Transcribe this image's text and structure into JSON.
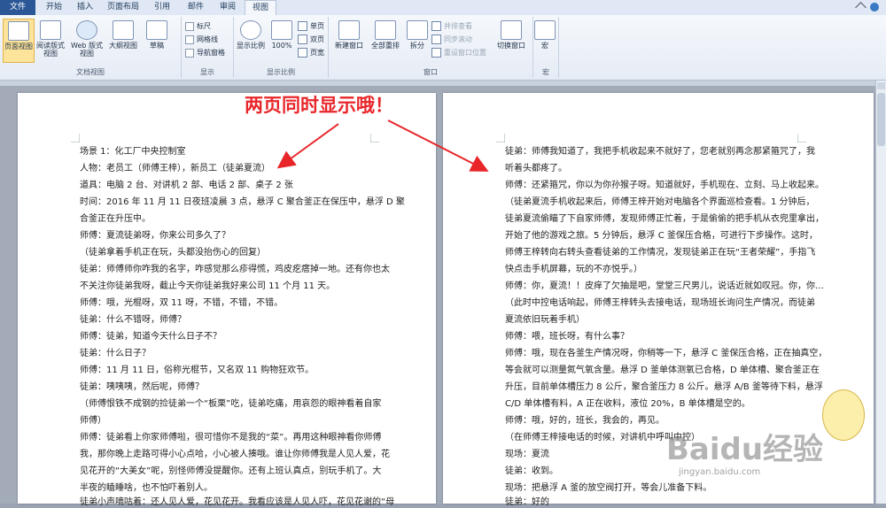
{
  "tabs": [
    "文件",
    "开始",
    "插入",
    "页面布局",
    "引用",
    "邮件",
    "审阅",
    "视图"
  ],
  "ribbon": {
    "doc_views": {
      "group_label": "文档视图",
      "buttons": [
        "页面视图",
        "阅读版式视图",
        "Web 版式视图",
        "大纲视图",
        "草稿"
      ]
    },
    "show": {
      "group_label": "显示",
      "items": [
        "标尺",
        "网格线",
        "导航窗格"
      ]
    },
    "zoom": {
      "group_label": "显示比例",
      "buttons": [
        "显示比例",
        "100%"
      ],
      "small": [
        "单页",
        "双页",
        "页宽"
      ]
    },
    "window": {
      "group_label": "窗口",
      "buttons": [
        "新建窗口",
        "全部重排",
        "拆分"
      ],
      "small": [
        "并排查看",
        "同步滚动",
        "重设窗口位置"
      ],
      "switch": "切换窗口"
    },
    "macro": {
      "group_label": "宏",
      "button": "宏"
    }
  },
  "annotation": "两页同时显示哦！",
  "page_left": [
    "场景 1：化工厂中央控制室",
    "人物：老员工（师傅王梓），新员工（徒弟夏流）",
    "道具：电脑 2 台、对讲机 2 部、电话 2 部、桌子 2 张",
    "时间：2016 年 11 月 11 日夜班凌晨 3 点，悬浮 C 聚合釜正在保压中，悬浮 D 聚",
    "合釜正在升压中。",
    "师傅：夏流徒弟呀，你来公司多久了？",
    "（徒弟拿着手机正在玩，头都没抬伤心的回复）",
    "徒弟：师傅师你咋我的名字，咋感觉那么疹得慌，鸡皮疙瘩掉一地。还有你也太",
    "不关注你徒弟我呀，截止今天你徒弟我好来公司 11 个月 11 天。",
    "师傅：哦，光棍呀，双 11 呀，不错，不错，不错。",
    "徒弟：什么不错呀，师傅？",
    "师傅：徒弟，知道今天什么日子不？",
    "徒弟：什么日子？",
    "师傅：11 月 11 日，俗称光棍节，又名双 11 购物狂欢节。",
    "徒弟：咦咦咦，然后呢，师傅？",
    "（师傅恨铁不成钢的捡徒弟一个“板栗”吃，徒弟吃痛，用哀怨的眼神看着自家",
    "师傅）",
    "师傅：徒弟看上你家师傅啦，很可惜你不是我的“菜”。再用这种眼神看你师傅",
    "我，那你晚上走路可得小心点哈，小心被人揍哦。谁让你师傅我是人见人爱，花",
    "见花开的“大美女”呢，别怪师傅没提醒你。还有上班认真点，别玩手机了。大",
    "半夜的瞌睡啥，也不怕吓着别人。",
    "徒弟小声嘀咕着：还人见人爱，花见花开。我看应该是人见人吓，花见花谢的“母"
  ],
  "page_right": [
    "徒弟：师傅我知道了，我把手机收起来不就好了，您老就别再念那紧箍咒了，我",
    "听着头都疼了。",
    "师傅：还紧箍咒，你以为你孙猴子呀。知道就好，手机现在、立刻、马上收起来。",
    "（徒弟夏流手机收起来后，师傅王梓开始对电脑各个界面巡检查看。1 分钟后，",
    "徒弟夏流偷瞄了下自家师傅，发现师傅正忙着，于是偷偷的把手机从衣兜里拿出，",
    "开始了他的游戏之旅。5 分钟后，悬浮 C 釜保压合格，可进行下步操作。这时，",
    "师傅王梓转向右转头查看徒弟的工作情况，发现徒弟正在玩“王者荣耀”，手指飞",
    "快点击手机屏幕，玩的不亦悦乎。）",
    "师傅：你，夏流！！皮痒了欠抽是吧，堂堂三尺男儿，说话近就如叹冠。你，你…",
    "（此时中控电话响起，师傅王梓转头去接电话，现场班长询问生产情况，而徒弟",
    "夏流依旧玩着手机）",
    "师傅：喂，班长呀，有什么事？",
    "师傅：哦，现在各釜生产情况呀，你稍等一下，悬浮 C 釜保压合格，正在抽真空，",
    "等会就可以测量氮气氧含量。悬浮 D 釜单体测氧已合格，D 单体槽、聚合釜正在",
    "升压，目前单体槽压力 8 公斤，聚合釜压力 8 公斤。悬浮 A/B 釜等待下料，悬浮",
    "C/D 单体槽有料，A 正在收料，液位 20%，B 单体槽是空的。",
    "师傅：哦，好的，班长，我会的，再见。",
    "（在师傅王梓接电话的时候，对讲机中呼叫中控）",
    "现场：夏流",
    "徒弟：收到。",
    "现场：把悬浮 A 釜的放空阀打开，等会儿准备下料。",
    "徒弟：好的"
  ],
  "watermark": "Baidu经验",
  "watermark_sub": "jingyan.baidu.com"
}
